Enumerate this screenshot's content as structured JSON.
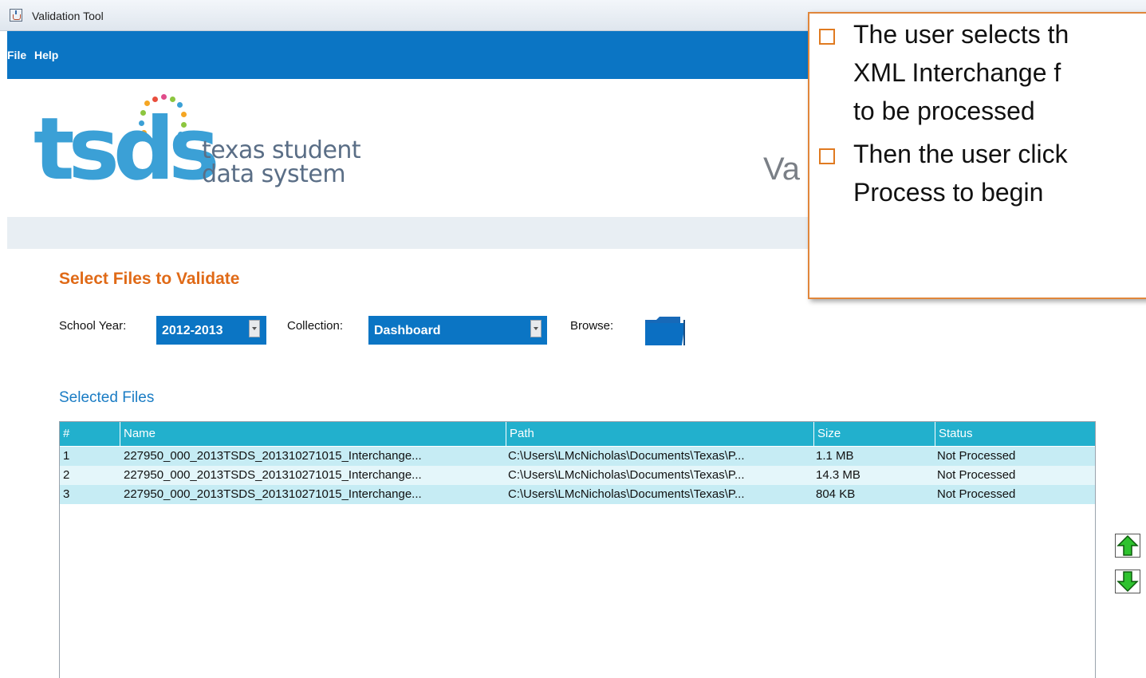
{
  "window": {
    "title": "Validation Tool"
  },
  "menu": {
    "items": [
      "File",
      "Help"
    ]
  },
  "logo": {
    "wordmark": "tsds",
    "tagline_line1": "texas student",
    "tagline_line2": "data system"
  },
  "header_partial_text": "Va",
  "section": {
    "title": "Select Files to Validate"
  },
  "filters": {
    "school_year_label": "School Year:",
    "school_year_value": "2012-2013",
    "collection_label": "Collection:",
    "collection_value": "Dashboard",
    "browse_label": "Browse:"
  },
  "selected_files": {
    "title": "Selected Files",
    "columns": [
      "#",
      "Name",
      "Path",
      "Size",
      "Status"
    ],
    "rows": [
      [
        "1",
        "227950_000_2013TSDS_201310271015_Interchange...",
        "C:\\Users\\LMcNicholas\\Documents\\Texas\\P...",
        "1.1 MB",
        "Not Processed"
      ],
      [
        "2",
        "227950_000_2013TSDS_201310271015_Interchange...",
        "C:\\Users\\LMcNicholas\\Documents\\Texas\\P...",
        "14.3 MB",
        "Not Processed"
      ],
      [
        "3",
        "227950_000_2013TSDS_201310271015_Interchange...",
        "C:\\Users\\LMcNicholas\\Documents\\Texas\\P...",
        "804 KB",
        "Not Processed"
      ]
    ]
  },
  "callout": {
    "bullet1_lines": [
      "The user selects th",
      "XML Interchange f",
      "to be processed"
    ],
    "bullet2_lines": [
      "Then the user click",
      "Process to begin"
    ]
  },
  "icons": {
    "browse": "folder-icon",
    "move_up": "arrow-up-icon",
    "move_down": "arrow-down-icon",
    "app": "java-icon"
  },
  "colors": {
    "menubar": "#0b75c4",
    "section_title": "#e06a17",
    "table_header": "#22b0cd",
    "row_odd": "#c6ecf4",
    "row_even": "#e4f6fa",
    "callout_border": "#e0863b"
  }
}
